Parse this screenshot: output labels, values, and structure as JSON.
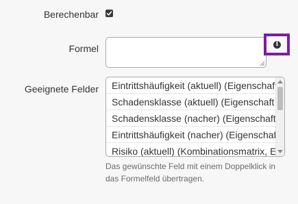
{
  "form": {
    "berechenbar": {
      "label": "Berechenbar",
      "checked": true
    },
    "formel": {
      "label": "Formel",
      "value": "",
      "info_icon": "info-icon",
      "highlight_color": "#7a1ea1"
    },
    "geeignete_felder": {
      "label": "Geeignete Felder",
      "items": [
        "Eintrittshäufigkeit (aktuell) (Eigenschaft",
        "Schadensklasse (aktuell) (Eigenschaft",
        "Schadensklasse (nacher) (Eigenschaft",
        "Eintrittshäufigkeit (nacher) (Eigenschaft",
        "Risiko (aktuell) (Kombinationsmatrix, E"
      ],
      "help": "Das gewünschte Feld mit einem Doppelklick in das Formelfeld übertragen."
    }
  }
}
